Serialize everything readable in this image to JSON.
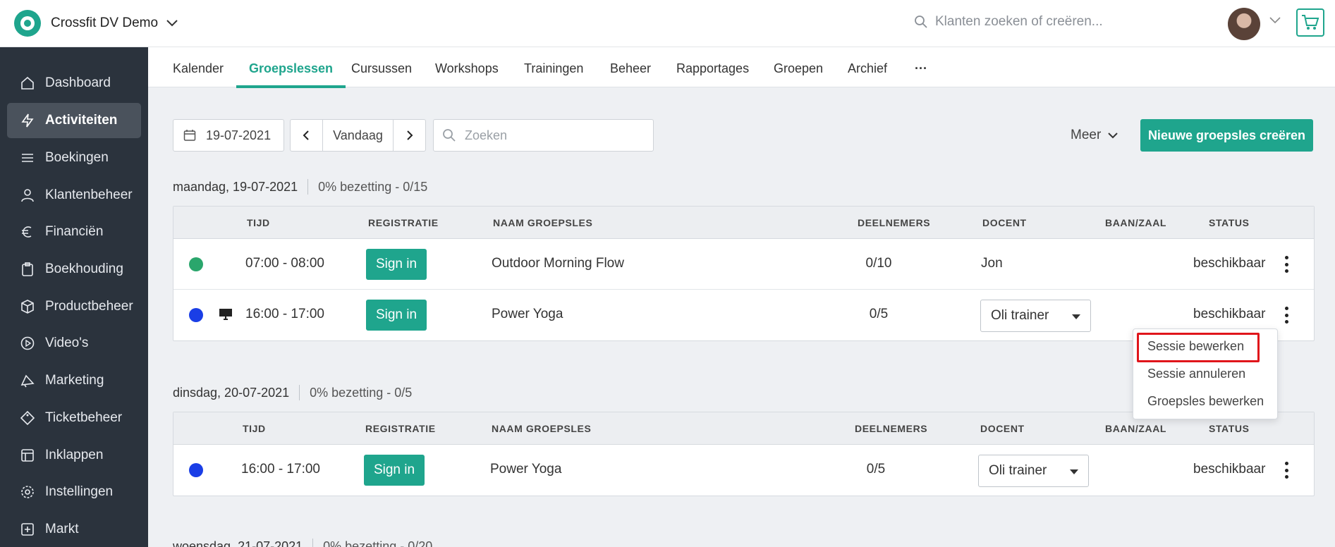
{
  "app": {
    "brand_name": "Crossfit DV Demo",
    "search_placeholder": "Klanten zoeken of creëren...",
    "accent_color": "#1fa58d"
  },
  "sidebar": {
    "items": [
      {
        "label": "Dashboard",
        "icon": "home-icon",
        "active": false
      },
      {
        "label": "Activiteiten",
        "icon": "bolt-icon",
        "active": true
      },
      {
        "label": "Boekingen",
        "icon": "list-icon",
        "active": false
      },
      {
        "label": "Klantenbeheer",
        "icon": "user-icon",
        "active": false
      },
      {
        "label": "Financiën",
        "icon": "euro-icon",
        "active": false
      },
      {
        "label": "Boekhouding",
        "icon": "clipboard-icon",
        "active": false
      },
      {
        "label": "Productbeheer",
        "icon": "box-icon",
        "active": false
      },
      {
        "label": "Video's",
        "icon": "play-icon",
        "active": false
      },
      {
        "label": "Marketing",
        "icon": "megaphone-icon",
        "active": false
      },
      {
        "label": "Ticketbeheer",
        "icon": "ticket-icon",
        "active": false
      },
      {
        "label": "Inklappen",
        "icon": "collapse-icon",
        "active": false
      },
      {
        "label": "Instellingen",
        "icon": "gear-icon",
        "active": false
      },
      {
        "label": "Markt",
        "icon": "plus-square-icon",
        "active": false
      }
    ]
  },
  "tabs": [
    {
      "label": "Kalender",
      "active": false
    },
    {
      "label": "Groepslessen",
      "active": true
    },
    {
      "label": "Cursussen",
      "active": false
    },
    {
      "label": "Workshops",
      "active": false
    },
    {
      "label": "Trainingen",
      "active": false
    },
    {
      "label": "Beheer",
      "active": false
    },
    {
      "label": "Rapportages",
      "active": false
    },
    {
      "label": "Groepen",
      "active": false
    },
    {
      "label": "Archief",
      "active": false
    },
    {
      "label": "···",
      "active": false
    }
  ],
  "toolbar": {
    "date_value": "19-07-2021",
    "today_label": "Vandaag",
    "search_placeholder": "Zoeken",
    "more_label": "Meer",
    "create_label": "Nieuwe groepsles creëren"
  },
  "columns": {
    "time": "TIJD",
    "registration": "REGISTRATIE",
    "name": "NAAM GROEPSLES",
    "participants": "DEELNEMERS",
    "teacher": "DOCENT",
    "court": "BAAN/ZAAL",
    "status": "STATUS"
  },
  "days": [
    {
      "date": "maandag, 19-07-2021",
      "occupancy": "0% bezetting - 0/15",
      "sessions": [
        {
          "color": "#2aa66c",
          "online": false,
          "time": "07:00 - 08:00",
          "signin": "Sign in",
          "name": "Outdoor Morning Flow",
          "participants": "0/10",
          "teacher": "Jon",
          "teacher_select": false,
          "status": "beschikbaar"
        },
        {
          "color": "#1a3ee6",
          "online": true,
          "time": "16:00 - 17:00",
          "signin": "Sign in",
          "name": "Power Yoga",
          "participants": "0/5",
          "teacher": "Oli trainer",
          "teacher_select": true,
          "status": "beschikbaar"
        }
      ]
    },
    {
      "date": "dinsdag, 20-07-2021",
      "occupancy": "0% bezetting - 0/5",
      "sessions": [
        {
          "color": "#1a3ee6",
          "online": false,
          "time": "16:00 - 17:00",
          "signin": "Sign in",
          "name": "Power Yoga",
          "participants": "0/5",
          "teacher": "Oli trainer",
          "teacher_select": true,
          "status": "beschikbaar"
        }
      ]
    },
    {
      "date": "woensdag, 21-07-2021",
      "occupancy": "0% bezetting - 0/20"
    }
  ],
  "context_menu": {
    "items": [
      "Sessie bewerken",
      "Sessie annuleren",
      "Groepsles bewerken"
    ],
    "highlighted": "Sessie bewerken",
    "highlight_color": "#e0151b"
  }
}
